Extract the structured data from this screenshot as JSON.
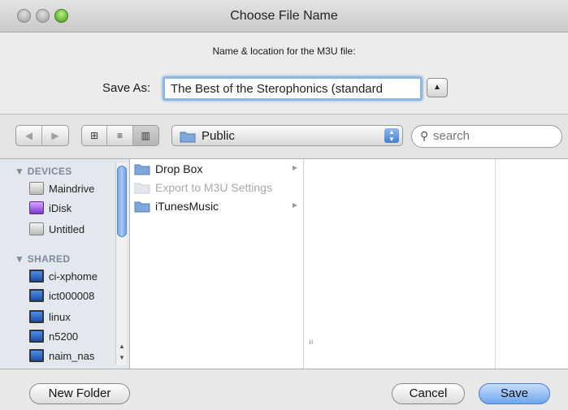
{
  "window": {
    "title": "Choose File Name"
  },
  "dialog": {
    "subtitle": "Name & location for the M3U file:",
    "save_as_label": "Save As:",
    "save_as_value": "The Best of the Sterophonics (standard",
    "expand_glyph": "▲"
  },
  "toolbar": {
    "back_glyph": "◀",
    "forward_glyph": "▶",
    "view_icons_glyph": "⊞",
    "view_list_glyph": "≡",
    "view_columns_glyph": "▥",
    "location": "Public",
    "search_placeholder": "search"
  },
  "sidebar": {
    "devices_header": "▼ DEVICES",
    "devices": [
      {
        "label": "Maindrive",
        "icon": "drive-icon"
      },
      {
        "label": "iDisk",
        "icon": "idisk-icon"
      },
      {
        "label": "Untitled",
        "icon": "drive-icon"
      }
    ],
    "shared_header": "▼ SHARED",
    "shared": [
      {
        "label": "ci-xphome",
        "icon": "monitor-icon"
      },
      {
        "label": "ict000008",
        "icon": "monitor-icon"
      },
      {
        "label": "linux",
        "icon": "monitor-icon"
      },
      {
        "label": "n5200",
        "icon": "monitor-icon"
      },
      {
        "label": "naim_nas",
        "icon": "monitor-icon"
      }
    ]
  },
  "column1": {
    "items": [
      {
        "label": "Drop Box",
        "dimmed": false
      },
      {
        "label": "Export to M3U Settings",
        "dimmed": true
      },
      {
        "label": "iTunesMusic",
        "dimmed": false
      }
    ]
  },
  "column_resize_glyph": "ıı",
  "buttons": {
    "new_folder": "New Folder",
    "cancel": "Cancel",
    "save": "Save"
  },
  "colors": {
    "accent": "#6ea6ec",
    "folder": "#7fa8da"
  }
}
